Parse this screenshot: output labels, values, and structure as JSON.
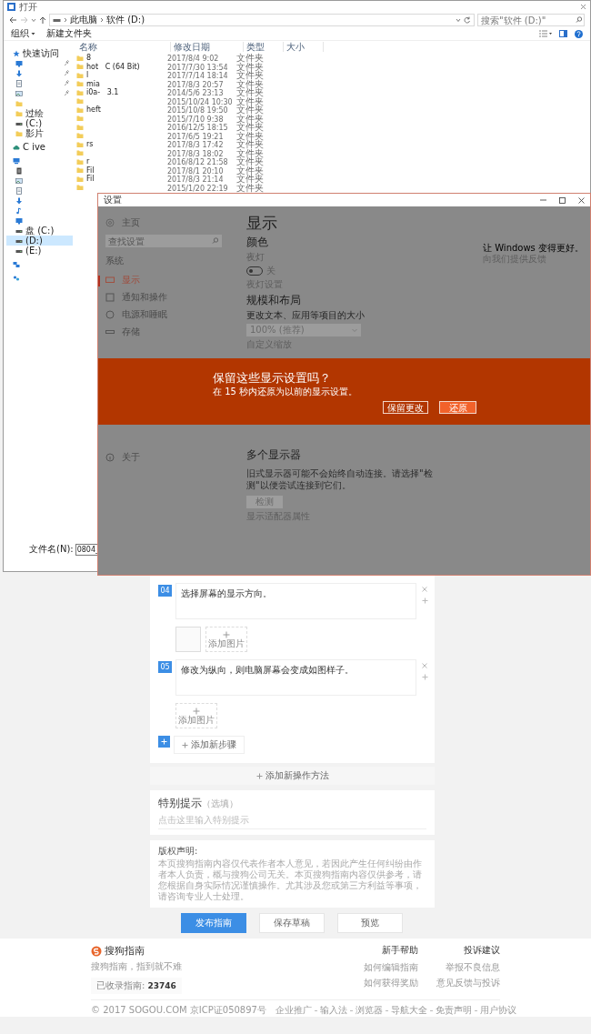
{
  "file_dialog": {
    "title": "打开",
    "path": [
      "此电脑",
      "软件 (D:)"
    ],
    "search": {
      "placeholder": "搜索\"软件 (D:)\""
    },
    "toolbar": [
      "组织",
      "新建文件夹"
    ],
    "columns": [
      "名称",
      "修改日期",
      "类型",
      "大小"
    ],
    "nav": [
      {
        "kind": "star",
        "label": "快速访问",
        "selected": false,
        "pinned": false,
        "children": [
          {
            "kind": "desktop",
            "selected": false,
            "pinned": true
          },
          {
            "kind": "download",
            "selected": false,
            "pinned": true
          },
          {
            "kind": "document",
            "selected": false,
            "pinned": true
          },
          {
            "kind": "picture",
            "selected": false,
            "pinned": true
          },
          {
            "kind": "folder",
            "selected": false,
            "pinned": false
          },
          {
            "kind": "folder",
            "label": "过绘",
            "selected": false,
            "pinned": false
          },
          {
            "kind": "drive",
            "label": "(C:)",
            "selected": false,
            "pinned": false
          },
          {
            "kind": "folder",
            "label": "影片",
            "selected": false,
            "pinned": false
          }
        ]
      },
      {
        "kind": "cloud",
        "label": "C ive",
        "selected": false,
        "pinned": false
      },
      {
        "kind": "pc",
        "selected": false,
        "pinned": false,
        "children": [
          {
            "kind": "video",
            "selected": false,
            "pinned": false
          },
          {
            "kind": "picture",
            "selected": false,
            "pinned": false
          },
          {
            "kind": "document",
            "selected": false,
            "pinned": false
          },
          {
            "kind": "download",
            "selected": false,
            "pinned": false
          },
          {
            "kind": "music",
            "selected": false,
            "pinned": false
          },
          {
            "kind": "desktop",
            "selected": false,
            "pinned": false
          },
          {
            "kind": "drive",
            "label": "盘 (C:)",
            "selected": false,
            "pinned": false
          },
          {
            "kind": "drive",
            "label": "(D:)",
            "selected": true,
            "pinned": false
          },
          {
            "kind": "drive",
            "label": "(E:)",
            "selected": false,
            "pinned": false
          }
        ]
      },
      {
        "kind": "network",
        "selected": false,
        "pinned": false
      },
      {
        "kind": "homegroup",
        "selected": false,
        "pinned": false
      }
    ],
    "rows": [
      {
        "name": "8",
        "modified": "2017/8/4 9:02",
        "type": "文件夹"
      },
      {
        "name": "hot   C (64 Bit)",
        "modified": "2017/7/30 13:54",
        "type": "文件夹"
      },
      {
        "name": "l",
        "modified": "2017/7/14 18:14",
        "type": "文件夹"
      },
      {
        "name": "mia",
        "modified": "2017/8/3 20:57",
        "type": "文件夹"
      },
      {
        "name": "i0a-   3.1",
        "modified": "2014/5/6 23:13",
        "type": "文件夹"
      },
      {
        "name": "",
        "modified": "2015/10/24 10:30",
        "type": "文件夹"
      },
      {
        "name": "heft",
        "modified": "2015/10/8 19:50",
        "type": "文件夹"
      },
      {
        "name": "",
        "modified": "2015/7/10 9:38",
        "type": "文件夹"
      },
      {
        "name": "",
        "modified": "2016/12/5 18:15",
        "type": "文件夹"
      },
      {
        "name": "",
        "modified": "2017/6/5 19:21",
        "type": "文件夹"
      },
      {
        "name": "rs",
        "modified": "2017/8/3 17:42",
        "type": "文件夹"
      },
      {
        "name": "",
        "modified": "2017/8/3 18:02",
        "type": "文件夹"
      },
      {
        "name": "r",
        "modified": "2016/8/12 21:58",
        "type": "文件夹"
      },
      {
        "name": "Fil",
        "modified": "2017/8/1 20:10",
        "type": "文件夹"
      },
      {
        "name": "Fil",
        "modified": "2017/8/3 21:14",
        "type": "文件夹"
      },
      {
        "name": "",
        "modified": "2015/1/20 22:19",
        "type": "文件夹"
      }
    ],
    "filename": {
      "label": "文件名(N):",
      "value": "0804_"
    }
  },
  "settings": {
    "title": "设置",
    "home": "主页",
    "search": {
      "placeholder": "查找设置"
    },
    "section": "系统",
    "nav_items": [
      {
        "kind": "display",
        "label": "显示",
        "selected": true
      },
      {
        "kind": "notification",
        "label": "通知和操作",
        "selected": false
      },
      {
        "kind": "power",
        "label": "电源和睡眠",
        "selected": false
      },
      {
        "kind": "storage",
        "label": "存储",
        "selected": false
      }
    ],
    "lower_nav_items": [
      {
        "kind": "about",
        "label": "关于",
        "selected": false
      }
    ],
    "heading": "显示",
    "color_heading": "颜色",
    "night_light": {
      "label": "夜灯",
      "on": false,
      "state_label": "关",
      "settings_link": "夜灯设置"
    },
    "scale_heading": "规模和布局",
    "scale_label": "更改文本、应用等项目的大小",
    "scale_value": "100% (推荐)",
    "custom_scale_link": "自定义缩放",
    "multi_heading": "多个显示器",
    "multi_text": "旧式显示器可能不会始终自动连接。请选择\"检测\"以便尝试连接到它们。",
    "detect_button": "检测",
    "adapter_link": "显示适配器属性",
    "side_title": "让 Windows 变得更好。",
    "side_link": "向我们提供反馈",
    "banner": {
      "title": "保留这些显示设置吗？",
      "text": "在 15 秒内还原为以前的显示设置。",
      "buttons": [
        {
          "label": "保留更改",
          "primary": false
        },
        {
          "label": "还原",
          "primary": true
        }
      ]
    }
  },
  "guide": {
    "steps": [
      {
        "number": "04",
        "text": "选择屏幕的显示方向。",
        "has_thumbnail": true,
        "add_image": "添加图片"
      },
      {
        "number": "05",
        "text": "修改为纵向，则电脑屏幕会变成如图样子。",
        "has_thumbnail": false,
        "add_image": "添加图片"
      }
    ],
    "add_step": "添加新步骤",
    "add_method": "添加新操作方法",
    "tips": {
      "title": "特别提示",
      "note": "（选填）",
      "placeholder": "点击这里输入特别提示"
    },
    "copyright": {
      "title": "版权声明:",
      "text": "本页搜狗指南内容仅代表作者本人意见，若因此产生任何纠纷由作者本人负责，概与搜狗公司无关。本页搜狗指南内容仅供参考，请您根据自身实际情况谨慎操作。尤其涉及您或第三方利益等事项，请咨询专业人士处理。"
    },
    "actions": [
      {
        "label": "发布指南",
        "primary": true
      },
      {
        "label": "保存草稿",
        "primary": false
      },
      {
        "label": "预览",
        "primary": false
      }
    ]
  },
  "footer": {
    "logo": "搜狗指南",
    "slogan": "搜狗指南，指到就不难",
    "count_label": "已收录指南:",
    "count": "23746",
    "columns": [
      {
        "title": "新手帮助",
        "links": [
          "如何编辑指南",
          "如何获得奖励"
        ]
      },
      {
        "title": "投诉建议",
        "links": [
          "举报不良信息",
          "意见反馈与投诉"
        ]
      }
    ],
    "copyright": "© 2017 SOGOU.COM 京ICP证050897号",
    "links": [
      "企业推广",
      "输入法",
      "浏览器",
      "导航大全",
      "免责声明",
      "用户协议"
    ]
  }
}
